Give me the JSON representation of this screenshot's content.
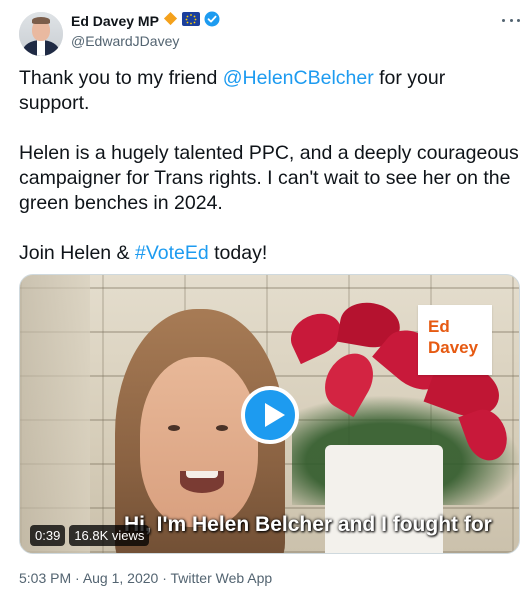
{
  "author": {
    "display_name": "Ed Davey MP",
    "handle": "@EdwardJDavey",
    "badges": [
      "orange-diamond-emoji",
      "eu-flag-emoji",
      "verified-badge-icon"
    ]
  },
  "tweet": {
    "line1_prefix": "Thank you to my friend ",
    "line1_mention": "@HelenCBelcher",
    "line1_suffix": " for your support.",
    "para2": "Helen is a hugely talented PPC, and a deeply courageous campaigner for Trans rights. I can't wait to see her on the green benches in 2024.",
    "para3_prefix": "Join Helen & ",
    "para3_hashtag": "#VoteEd",
    "para3_suffix": " today!"
  },
  "video": {
    "logo_line1": "Ed",
    "logo_line2": "Davey",
    "caption": "Hi, I'm Helen Belcher and I fought for",
    "duration": "0:39",
    "views": "16.8K views"
  },
  "meta": {
    "time": "5:03 PM",
    "separator": " · ",
    "date": "Aug 1, 2020",
    "source": "Twitter Web App"
  },
  "colors": {
    "link": "#1d9bf0",
    "secondary_text": "#536471",
    "logo_orange": "#e65a12"
  }
}
